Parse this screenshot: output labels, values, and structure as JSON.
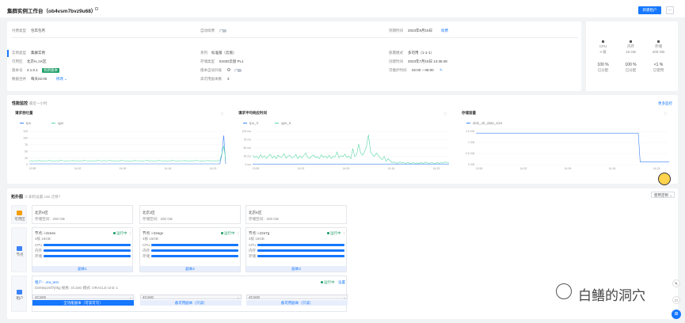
{
  "header": {
    "title": "集群实例工作台（ob4vsm7bvz9u68）",
    "primary_button": "新建租户",
    "copy_icon": "copy-icon"
  },
  "info": {
    "rows": [
      [
        [
          "付费类型",
          "包年包月"
        ],
        [
          "自动续费",
          ""
        ],
        [
          "到期时间",
          "2023年9月15日"
        ]
      ],
      [
        [
          "实例类型",
          "集群实例"
        ],
        [
          "系列",
          "标准版（云盘）"
        ],
        [
          "部署模式",
          "多可用（1-1-1）"
        ]
      ],
      [
        [
          "可用区",
          "北京H,J,K区"
        ],
        [
          "存储类型",
          "ESSD云盘 PL1"
        ],
        [
          "创建时间",
          "2023年7月15日 14:35:48"
        ]
      ],
      [
        [
          "版本号",
          "4.1.0.1"
        ],
        [
          "版本自动升级",
          ""
        ],
        [
          "可维护时间",
          "02:00 ~ 06:00"
        ]
      ],
      [
        [
          "数据合并",
          "每天02:00"
        ],
        [
          "高可用副本数",
          "3"
        ],
        [
          "",
          ""
        ]
      ]
    ],
    "renew_link": "续费",
    "version_tag": "有新版本",
    "merge_link": "修改"
  },
  "resources": [
    {
      "name": "CPU",
      "cap": "4 核",
      "pct": "100 %",
      "sub": "已分配"
    },
    {
      "name": "内存",
      "cap": "16 GB",
      "pct": "100 %",
      "sub": "已分配"
    },
    {
      "name": "存储",
      "cap": "200 GB",
      "pct": "<1 %",
      "sub": "已使用"
    }
  ],
  "monitor": {
    "title": "性能监控",
    "range": "最近一小时",
    "more": "更多监控",
    "charts": [
      {
        "title": "请求吞吐量",
        "legend": [
          "tps",
          "qps"
        ]
      },
      {
        "title": "请求平均响应时间",
        "legend": [
          "tps_rt",
          "qps_rt"
        ]
      },
      {
        "title": "存储容量",
        "legend": [
          "disk_ob_data_size"
        ]
      }
    ]
  },
  "chart_data": [
    {
      "type": "line",
      "title": "请求吞吐量",
      "x": [
        "13:55",
        "14:02",
        "14:09",
        "14:16",
        "14:23"
      ],
      "ylim": [
        0,
        125
      ],
      "yticks": [
        "0",
        "25",
        "50",
        "75",
        "100",
        "125"
      ],
      "series": [
        {
          "name": "tps",
          "color": "#3b82f6",
          "values": [
            3,
            3,
            3,
            3,
            3,
            3,
            3,
            3,
            3,
            3,
            3,
            3,
            3,
            3,
            3,
            3,
            3,
            3,
            3,
            3,
            3,
            3,
            3,
            3,
            3,
            3,
            3,
            3,
            3,
            3,
            3,
            3,
            3,
            3,
            3,
            3,
            3,
            3,
            3,
            3,
            3,
            3,
            3,
            3,
            3,
            3,
            3,
            3,
            3,
            3,
            3,
            3,
            3,
            3,
            3,
            3,
            3,
            3,
            3,
            3,
            3,
            3,
            3,
            3,
            3,
            3,
            3,
            3,
            3,
            3,
            3,
            3,
            3,
            3,
            3,
            3,
            3,
            3,
            3,
            3,
            3,
            3,
            3,
            3,
            3,
            3,
            3,
            3,
            3,
            3,
            3,
            3,
            3,
            3,
            3,
            3,
            3,
            3,
            35,
            110,
            3
          ]
        },
        {
          "name": "qps",
          "color": "#5ad8a6",
          "values": [
            14,
            15,
            14,
            15,
            14,
            16,
            14,
            15,
            14,
            15,
            16,
            14,
            15,
            14,
            15,
            14,
            16,
            15,
            14,
            15,
            14,
            15,
            16,
            14,
            15,
            14,
            15,
            14,
            16,
            15,
            14,
            15,
            14,
            15,
            14,
            16,
            15,
            14,
            15,
            14,
            15,
            16,
            14,
            15,
            14,
            15,
            14,
            16,
            15,
            14,
            15,
            14,
            15,
            14,
            16,
            15,
            14,
            15,
            14,
            15,
            16,
            14,
            15,
            14,
            15,
            14,
            16,
            15,
            14,
            15,
            14,
            15,
            14,
            16,
            15,
            14,
            15,
            14,
            15,
            16,
            14,
            15,
            14,
            15,
            14,
            16,
            15,
            14,
            15,
            14,
            15,
            16,
            14,
            15,
            14,
            15,
            14,
            16,
            40,
            70,
            20
          ]
        }
      ]
    },
    {
      "type": "line",
      "title": "请求平均响应时间",
      "x": [
        "13:55",
        "14:02",
        "14:09",
        "14:16",
        "14:23"
      ],
      "ylim": [
        0,
        100
      ],
      "yticks": [
        "0 ms",
        "25 ms",
        "50 ms",
        "75 ms",
        "100 ms"
      ],
      "series": [
        {
          "name": "tps_rt",
          "color": "#3b82f6",
          "values": [
            2,
            2,
            2,
            2,
            2,
            2,
            2,
            2,
            2,
            2,
            2,
            2,
            2,
            2,
            2,
            2,
            2,
            2,
            2,
            2,
            2,
            2,
            2,
            2,
            2,
            2,
            2,
            2,
            2,
            2,
            2,
            2,
            2,
            2,
            2,
            2,
            2,
            2,
            2,
            2,
            2,
            2,
            2,
            2,
            2,
            2,
            2,
            2,
            2,
            2,
            2,
            2,
            2,
            2,
            2,
            2,
            2,
            2,
            2,
            2,
            2,
            2,
            2,
            2,
            2,
            2,
            2,
            2,
            2,
            2,
            2,
            2,
            2,
            2,
            2,
            2,
            2,
            2,
            2,
            2,
            2,
            2,
            2,
            2,
            2,
            2,
            2,
            2,
            2,
            2,
            2,
            2,
            2,
            2,
            2,
            2,
            2,
            2,
            2,
            2,
            2
          ]
        },
        {
          "name": "qps_rt",
          "color": "#5ad8a6",
          "values": [
            28,
            22,
            26,
            18,
            30,
            21,
            27,
            19,
            25,
            32,
            20,
            26,
            18,
            29,
            22,
            24,
            33,
            19,
            25,
            28,
            20,
            23,
            31,
            18,
            26,
            21,
            27,
            35,
            22,
            19,
            25,
            29,
            21,
            24,
            18,
            30,
            22,
            26,
            20,
            28,
            19,
            25,
            23,
            38,
            21,
            27,
            24,
            32,
            22,
            26,
            18,
            48,
            24,
            30,
            62,
            35,
            28,
            40,
            55,
            90,
            40,
            30,
            25,
            35,
            28,
            20,
            15,
            25,
            10,
            18,
            12,
            6,
            8,
            5,
            4,
            8,
            5,
            6,
            3,
            7,
            4,
            5,
            6,
            3,
            5,
            4,
            6,
            3,
            8,
            5,
            4,
            6,
            5,
            3,
            7,
            4,
            6,
            5,
            8,
            6,
            7
          ]
        }
      ]
    },
    {
      "type": "line",
      "title": "存储容量",
      "x": [
        "13:55",
        "14:02",
        "14:09",
        "14:16",
        "14:23"
      ],
      "ylim": [
        0,
        1.5
      ],
      "yticks": [
        "0 GB",
        "0.5 GB",
        "1 GB",
        "1.5 GB"
      ],
      "series": [
        {
          "name": "disk_ob_data_size",
          "color": "#3b82f6",
          "values": [
            1.42,
            1.42,
            1.42,
            1.42,
            1.42,
            1.42,
            1.42,
            1.42,
            1.42,
            1.42,
            1.42,
            1.42,
            1.42,
            1.42,
            1.42,
            1.42,
            1.42,
            1.42,
            1.42,
            1.42,
            1.42,
            1.42,
            1.42,
            1.42,
            1.42,
            1.42,
            1.42,
            1.42,
            1.42,
            1.42,
            1.42,
            1.42,
            1.42,
            1.42,
            1.42,
            1.42,
            1.42,
            1.42,
            1.42,
            1.42,
            1.42,
            1.42,
            1.42,
            1.42,
            1.42,
            1.42,
            1.42,
            1.42,
            1.42,
            1.42,
            1.42,
            1.42,
            1.42,
            1.42,
            1.42,
            1.42,
            1.42,
            1.42,
            1.42,
            1.42,
            1.42,
            1.42,
            1.42,
            1.42,
            1.42,
            1.42,
            1.42,
            1.42,
            1.42,
            1.42,
            1.42,
            1.42,
            1.42,
            1.42,
            1.42,
            1.42,
            1.42,
            1.42,
            1.42,
            1.42,
            1.42,
            1.42,
            1.42,
            1.42,
            1.42,
            0.12,
            0.12,
            0.12,
            0.12,
            0.12,
            0.12,
            0.12,
            0.12,
            0.12,
            0.12,
            0.12,
            0.12,
            0.12,
            0.12,
            0.12,
            0.12
          ]
        }
      ]
    }
  ],
  "topology": {
    "title": "拓扑图",
    "hint": "① 如何设置 Unit 迁移？",
    "dropdown": "使用定制",
    "rows": [
      "可用区",
      "节点",
      "租户"
    ],
    "zones": [
      {
        "name": "北京H区",
        "storage": "存储空间：200 GB"
      },
      {
        "name": "北京J区",
        "storage": "存储空间：200 GB"
      },
      {
        "name": "北京K区",
        "storage": "存储空间：200 GB"
      }
    ],
    "nodes": [
      {
        "name": "节点: i-2ze4x",
        "status": "运行中",
        "spec": "4核 16GB",
        "foot": "副本1"
      },
      {
        "name": "节点: i-2zegv",
        "status": "运行中",
        "spec": "4核 16GB",
        "foot": "副本2"
      },
      {
        "name": "节点: i-2ze7g",
        "status": "运行中",
        "spec": "4核 16GB",
        "foot": "副本3"
      }
    ],
    "node_metrics": [
      "CPU",
      "内存",
      "存储"
    ],
    "tenant": {
      "name": "租户：ora_test",
      "detail": "t3vh8xpz6f7j0kg  规格: 4C16G  模式: ORACLE  Unit: 1",
      "status": "运行中",
      "action": "设置",
      "units": [
        "4C16G",
        "4C16G",
        "4C16G"
      ],
      "roles": [
        "全功能副本（可读可写）",
        "备可用副本（只读）",
        "备可用副本（只读）"
      ]
    }
  },
  "watermark": "白鳝的洞穴"
}
